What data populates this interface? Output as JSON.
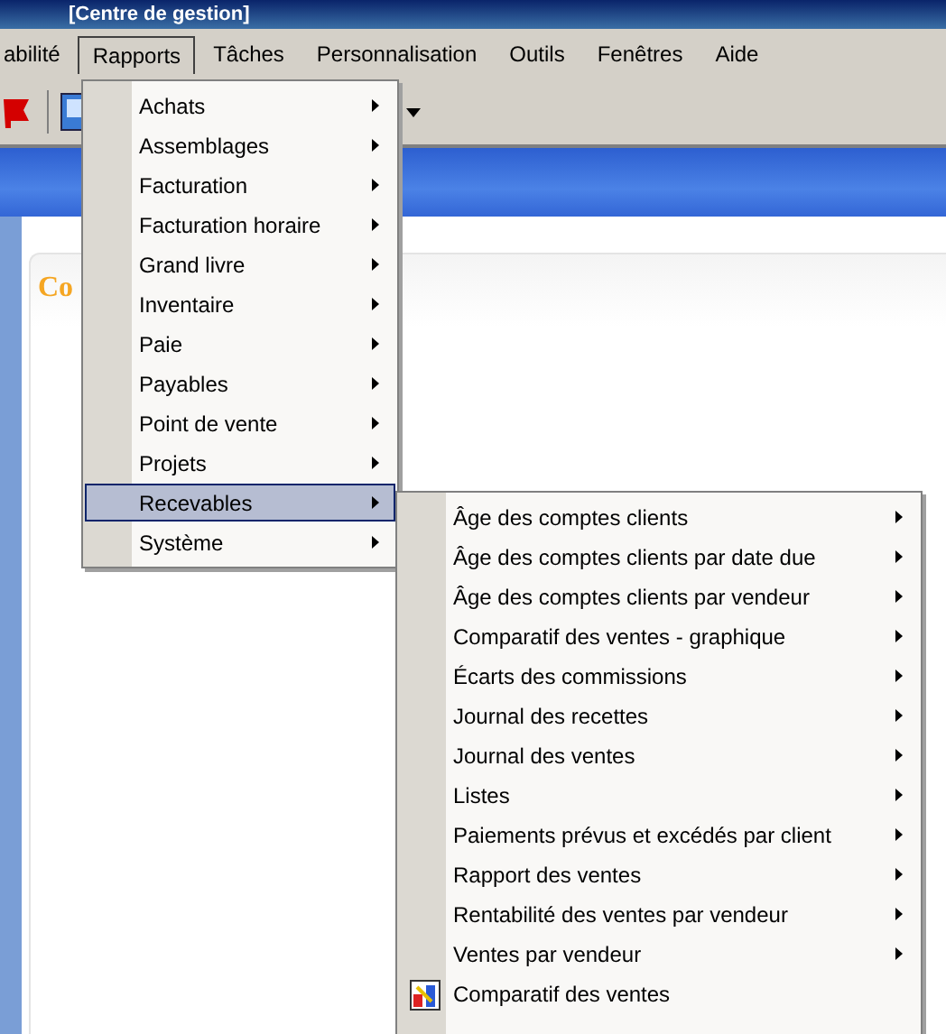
{
  "window": {
    "title": "[Centre de gestion]"
  },
  "menubar": [
    {
      "label": "abilité",
      "selected": false
    },
    {
      "label": "Rapports",
      "selected": true
    },
    {
      "label": "Tâches",
      "selected": false
    },
    {
      "label": "Personnalisation",
      "selected": false
    },
    {
      "label": "Outils",
      "selected": false
    },
    {
      "label": "Fenêtres",
      "selected": false
    },
    {
      "label": "Aide",
      "selected": false
    }
  ],
  "menu": {
    "items": [
      {
        "label": "Achats",
        "selected": false
      },
      {
        "label": "Assemblages",
        "selected": false
      },
      {
        "label": "Facturation",
        "selected": false
      },
      {
        "label": "Facturation horaire",
        "selected": false
      },
      {
        "label": "Grand livre",
        "selected": false
      },
      {
        "label": "Inventaire",
        "selected": false
      },
      {
        "label": "Paie",
        "selected": false
      },
      {
        "label": "Payables",
        "selected": false
      },
      {
        "label": "Point de vente",
        "selected": false
      },
      {
        "label": "Projets",
        "selected": false
      },
      {
        "label": "Recevables",
        "selected": true
      },
      {
        "label": "Système",
        "selected": false
      }
    ]
  },
  "submenu": {
    "items": [
      {
        "label": "Âge des comptes clients",
        "kind": "submenu"
      },
      {
        "label": "Âge des comptes clients par date due",
        "kind": "submenu"
      },
      {
        "label": "Âge des comptes clients par vendeur",
        "kind": "submenu"
      },
      {
        "label": "Comparatif des ventes - graphique",
        "kind": "submenu"
      },
      {
        "label": "Écarts des commissions",
        "kind": "submenu"
      },
      {
        "label": "Journal des recettes",
        "kind": "submenu"
      },
      {
        "label": "Journal des ventes",
        "kind": "submenu"
      },
      {
        "label": "Listes",
        "kind": "submenu"
      },
      {
        "label": "Paiements prévus et excédés par client",
        "kind": "submenu"
      },
      {
        "label": "Rapport des ventes",
        "kind": "submenu"
      },
      {
        "label": "Rentabilité des ventes par vendeur",
        "kind": "submenu"
      },
      {
        "label": "Ventes par vendeur",
        "kind": "submenu"
      },
      {
        "label": "Comparatif des ventes",
        "kind": "command"
      }
    ]
  },
  "content": {
    "heading": "Co"
  }
}
